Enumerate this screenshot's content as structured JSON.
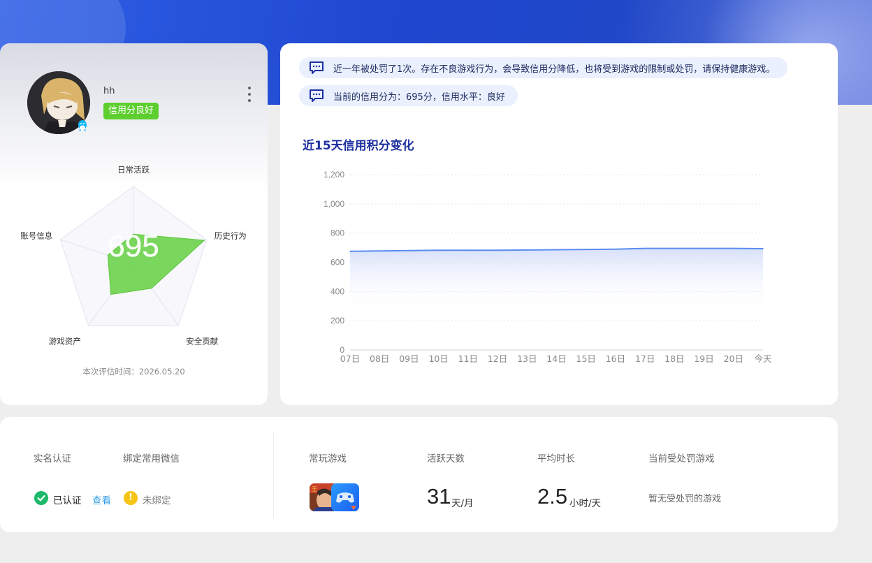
{
  "profile": {
    "username": "hh",
    "credit_badge": "信用分良好",
    "score": "695",
    "radar_axes": [
      "日常活跃",
      "历史行为",
      "安全贡献",
      "游戏资产",
      "账号信息"
    ],
    "radar_values": [
      0.38,
      0.97,
      0.4,
      0.5,
      0.35
    ],
    "eval_time": "本次评估时间：2026.05.20"
  },
  "notices": [
    "近一年被处罚了1次。存在不良游戏行为，会导致信用分降低，也将受到游戏的限制或处罚，请保持健康游戏。",
    "当前的信用分为：695分，信用水平：良好"
  ],
  "chart_data": {
    "type": "area",
    "title": "近15天信用积分变化",
    "categories": [
      "07日",
      "08日",
      "09日",
      "10日",
      "11日",
      "12日",
      "13日",
      "14日",
      "15日",
      "16日",
      "17日",
      "18日",
      "19日",
      "20日",
      "今天"
    ],
    "values": [
      675,
      678,
      680,
      682,
      682,
      682,
      684,
      686,
      688,
      690,
      695,
      695,
      695,
      695,
      693
    ],
    "ylim": [
      0,
      1200
    ],
    "yticks": [
      0,
      200,
      400,
      600,
      800,
      1000,
      1200
    ],
    "ytick_labels": [
      "0",
      "200",
      "400",
      "600",
      "800",
      "1,000",
      "1,200"
    ],
    "grid": true,
    "line_color": "#5b8def",
    "fill_color": "#d5dffa"
  },
  "bottom": {
    "labels": {
      "realname": "实名认证",
      "wechat": "绑定常用微信",
      "games": "常玩游戏",
      "active_days": "活跃天数",
      "avg_time": "平均时长",
      "punished_games": "当前受处罚游戏"
    },
    "realname_status": "已认证",
    "view_link": "查看",
    "wechat_status": "未绑定",
    "active_days_value": "31",
    "active_days_unit": "天/月",
    "avg_time_value": "2.5",
    "avg_time_unit": "小时/天",
    "punished_games_value": "暂无受处罚的游戏"
  },
  "colors": {
    "accent": "#1d2fa0",
    "badge_green": "#5ccf2e",
    "verified_green": "#1db96a",
    "warn_yellow": "#f7c415",
    "link_blue": "#38a0e8"
  }
}
